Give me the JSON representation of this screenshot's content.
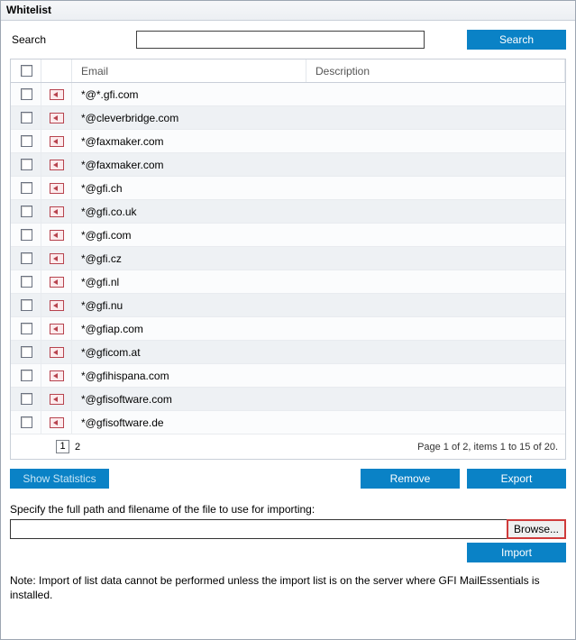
{
  "window": {
    "title": "Whitelist"
  },
  "search": {
    "label": "Search",
    "value": "",
    "button": "Search"
  },
  "table": {
    "headers": {
      "email": "Email",
      "description": "Description"
    },
    "rows": [
      {
        "email": "*@*.gfi.com",
        "description": ""
      },
      {
        "email": "*@cleverbridge.com",
        "description": ""
      },
      {
        "email": "*@faxmaker.com",
        "description": ""
      },
      {
        "email": "*@faxmaker.com",
        "description": ""
      },
      {
        "email": "*@gfi.ch",
        "description": ""
      },
      {
        "email": "*@gfi.co.uk",
        "description": ""
      },
      {
        "email": "*@gfi.com",
        "description": ""
      },
      {
        "email": "*@gfi.cz",
        "description": ""
      },
      {
        "email": "*@gfi.nl",
        "description": ""
      },
      {
        "email": "*@gfi.nu",
        "description": ""
      },
      {
        "email": "*@gfiap.com",
        "description": ""
      },
      {
        "email": "*@gficom.at",
        "description": ""
      },
      {
        "email": "*@gfihispana.com",
        "description": ""
      },
      {
        "email": "*@gfisoftware.com",
        "description": ""
      },
      {
        "email": "*@gfisoftware.de",
        "description": ""
      }
    ],
    "pager": {
      "current_page_box": "1",
      "next_page": "2",
      "status": "Page 1 of 2, items 1 to 15 of 20."
    }
  },
  "actions": {
    "show_statistics": "Show Statistics",
    "remove": "Remove",
    "export": "Export"
  },
  "import": {
    "label": "Specify the full path and filename of the file to use for importing:",
    "path": "",
    "browse": "Browse...",
    "button": "Import"
  },
  "note": "Note: Import of list data cannot be performed unless the import list is on the server where GFI MailEssentials is installed."
}
